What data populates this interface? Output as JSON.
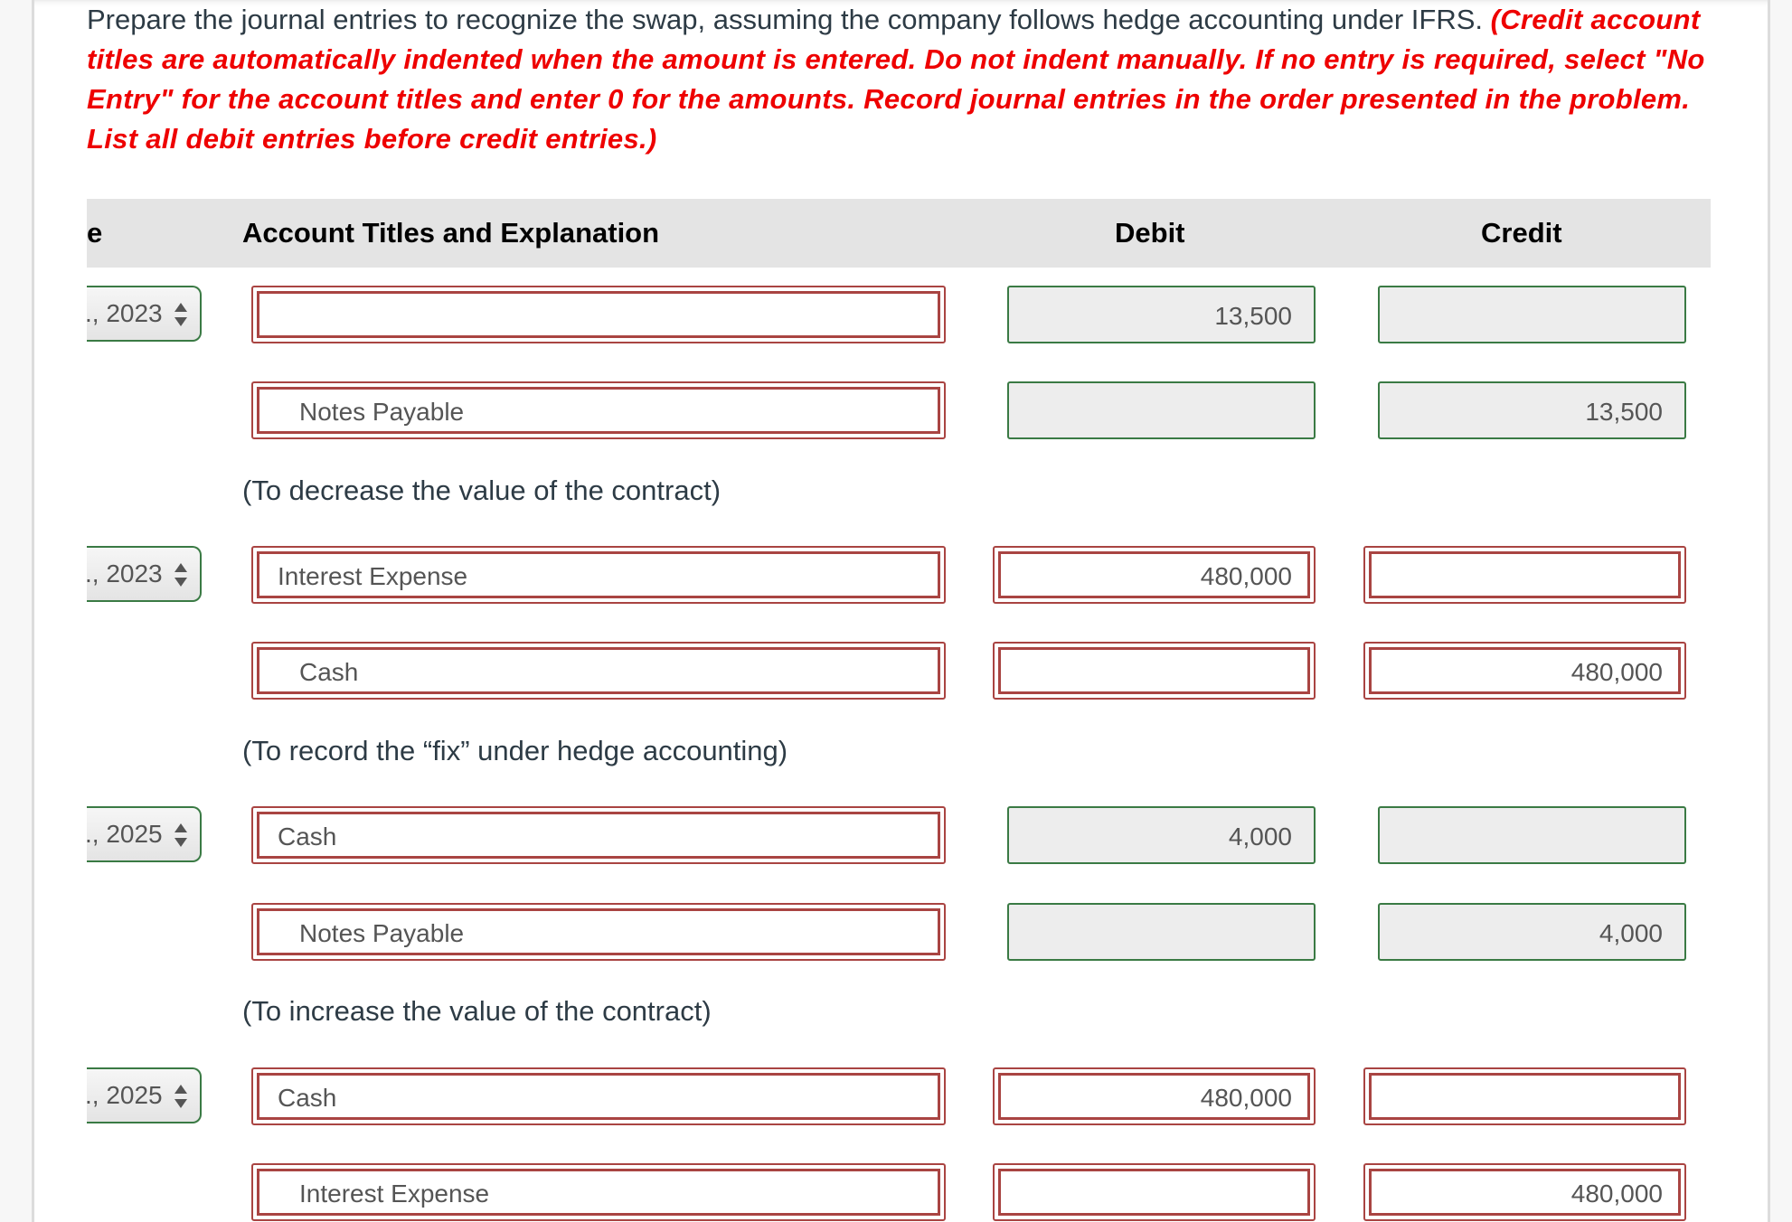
{
  "instructions": {
    "lead": "Prepare the journal entries to recognize the swap, assuming the company follows hedge accounting under IFRS.",
    "note": "(Credit account titles are automatically indented when the amount is entered. Do not indent manually. If no entry is required, select \"No Entry\" for the account titles and enter 0 for the amounts. Record journal entries in the order presented in the problem. List all debit entries before credit entries.)"
  },
  "table": {
    "headers": {
      "date": "e",
      "account": "Account Titles and Explanation",
      "debit": "Debit",
      "credit": "Credit"
    },
    "entries": [
      {
        "date": "., 2023",
        "lines": [
          {
            "account": "",
            "debit": "13,500",
            "credit": "",
            "account_status": "incorrect",
            "amount_status": "correct"
          },
          {
            "account": "Notes Payable",
            "debit": "",
            "credit": "13,500",
            "account_status": "incorrect",
            "amount_status": "correct"
          }
        ],
        "explanation": "(To decrease the value of the contract)"
      },
      {
        "date": "., 2023",
        "lines": [
          {
            "account": "Interest Expense",
            "debit": "480,000",
            "credit": "",
            "account_status": "incorrect",
            "amount_status": "incorrect"
          },
          {
            "account": "Cash",
            "debit": "",
            "credit": "480,000",
            "account_status": "incorrect",
            "amount_status": "incorrect"
          }
        ],
        "explanation": "(To record the “fix” under hedge accounting)"
      },
      {
        "date": "., 2025",
        "lines": [
          {
            "account": "Cash",
            "debit": "4,000",
            "credit": "",
            "account_status": "incorrect",
            "amount_status": "correct"
          },
          {
            "account": "Notes Payable",
            "debit": "",
            "credit": "4,000",
            "account_status": "incorrect",
            "amount_status": "correct"
          }
        ],
        "explanation": "(To increase the value of the contract)"
      },
      {
        "date": "., 2025",
        "lines": [
          {
            "account": "Cash",
            "debit": "480,000",
            "credit": "",
            "account_status": "incorrect",
            "amount_status": "incorrect"
          },
          {
            "account": "Interest Expense",
            "debit": "",
            "credit": "480,000",
            "account_status": "incorrect",
            "amount_status": "incorrect"
          }
        ]
      }
    ]
  },
  "colors": {
    "incorrect_border": "#a94442",
    "correct_border": "#3a7a44",
    "instruction_red": "#ee0000",
    "header_band": "#e4e4e4"
  }
}
